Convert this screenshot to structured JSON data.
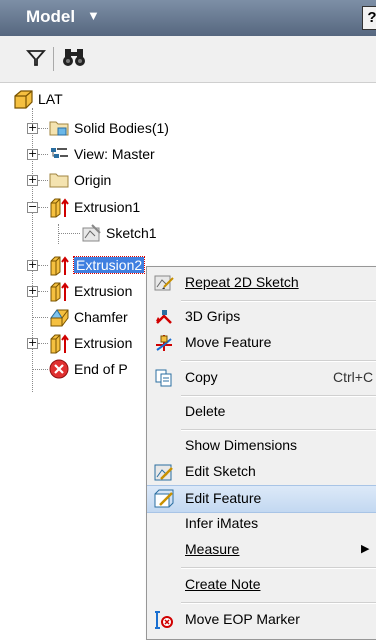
{
  "header": {
    "title": "Model",
    "help": "?"
  },
  "tree": {
    "root": "LAT",
    "items": [
      {
        "label": "Solid Bodies(1)"
      },
      {
        "label": "View: Master"
      },
      {
        "label": "Origin"
      },
      {
        "label": "Extrusion1"
      },
      {
        "label": "Sketch1"
      },
      {
        "label": "Extrusion2"
      },
      {
        "label": "Extrusion"
      },
      {
        "label": "Chamfer"
      },
      {
        "label": "Extrusion"
      },
      {
        "label": "End of P"
      }
    ]
  },
  "menu": {
    "items": [
      {
        "label": "Repeat 2D Sketch",
        "icon": "sketch-icon"
      },
      {
        "label": "3D Grips",
        "icon": "grips-icon"
      },
      {
        "label": "Move Feature",
        "icon": "move-feature-icon"
      },
      {
        "label": "Copy",
        "shortcut": "Ctrl+C",
        "icon": "copy-icon"
      },
      {
        "label": "Delete"
      },
      {
        "label": "Show Dimensions"
      },
      {
        "label": "Edit Sketch",
        "icon": "edit-sketch-icon"
      },
      {
        "label": "Edit Feature",
        "icon": "edit-feature-icon"
      },
      {
        "label": "Infer iMates"
      },
      {
        "label": "Measure"
      },
      {
        "label": "Create Note"
      },
      {
        "label": "Move EOP Marker",
        "icon": "eop-marker-icon"
      }
    ]
  }
}
